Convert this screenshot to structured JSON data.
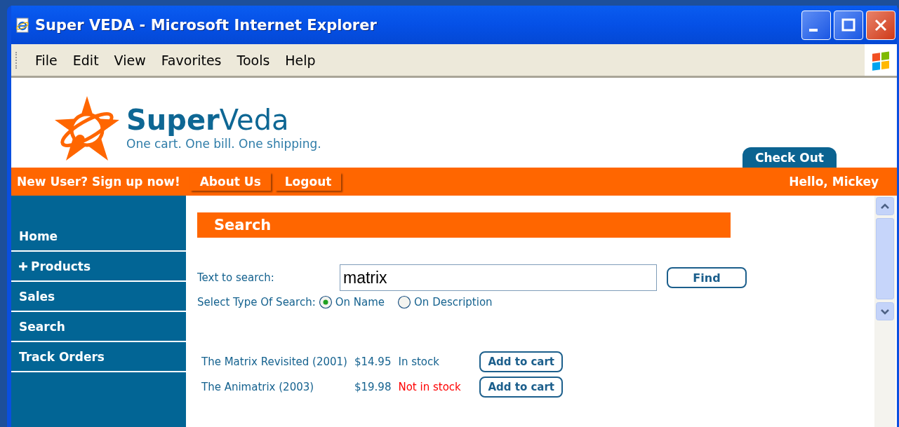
{
  "window": {
    "title": "Super VEDA - Microsoft Internet Explorer"
  },
  "menu": [
    "File",
    "Edit",
    "View",
    "Favorites",
    "Tools",
    "Help"
  ],
  "brand": {
    "name_bold": "Super",
    "name_light": "Veda",
    "tagline": "One cart. One bill. One shipping."
  },
  "checkout": "Check Out",
  "nav": {
    "signup": "New User? Sign up now!",
    "buttons": [
      "About Us",
      "Logout"
    ],
    "greeting": "Hello, Mickey"
  },
  "sidebar": {
    "items": [
      {
        "label": "Home",
        "expandable": false
      },
      {
        "label": "Products",
        "expandable": true
      },
      {
        "label": "Sales",
        "expandable": false
      },
      {
        "label": "Search",
        "expandable": false
      },
      {
        "label": "Track Orders",
        "expandable": false
      }
    ]
  },
  "search": {
    "heading": "Search",
    "text_label": "Text to search:",
    "value": "matrix",
    "find": "Find",
    "type_label": "Select Type Of Search:",
    "options": [
      {
        "label": "On Name",
        "selected": true
      },
      {
        "label": "On Description",
        "selected": false
      }
    ]
  },
  "results": [
    {
      "title": "The Matrix Revisited (2001)",
      "price": "$14.95",
      "stock": "In stock",
      "in_stock": true,
      "action": "Add to cart"
    },
    {
      "title": "The Animatrix (2003)",
      "price": "$19.98",
      "stock": "Not in stock",
      "in_stock": false,
      "action": "Add to cart"
    }
  ]
}
